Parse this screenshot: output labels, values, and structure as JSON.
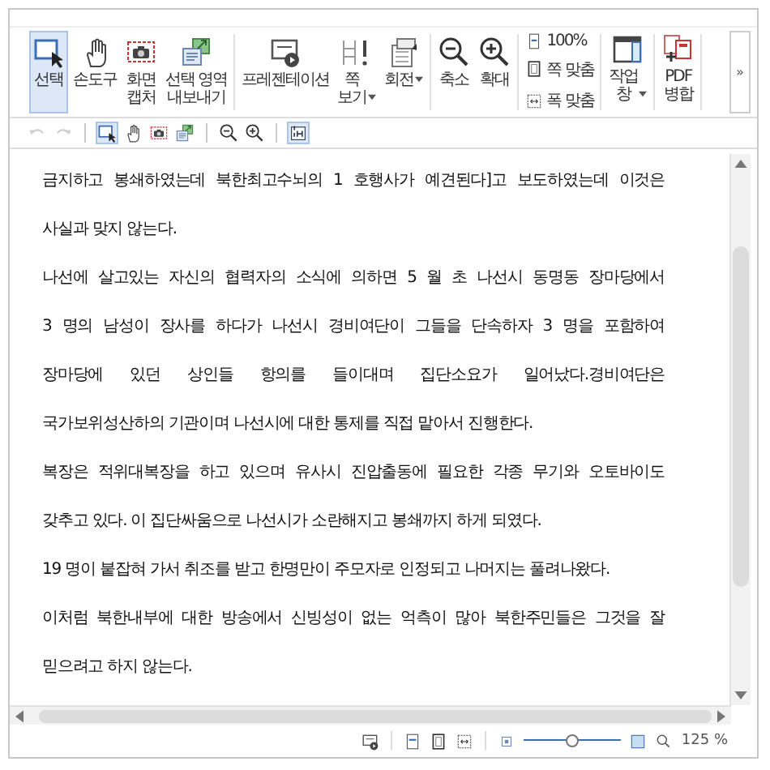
{
  "ribbon": {
    "groups": [
      {
        "buttons": [
          {
            "kind": "select",
            "label": "선택",
            "selected": true
          },
          {
            "kind": "hand",
            "label": "손도구",
            "selected": false
          },
          {
            "kind": "capture",
            "label": "화면\n캡처",
            "selected": false
          },
          {
            "kind": "export",
            "label": "선택 영역\n내보내기",
            "selected": false
          }
        ]
      },
      {
        "buttons": [
          {
            "kind": "present",
            "label": "프레젠테이션",
            "selected": false
          },
          {
            "kind": "pageview",
            "label": "쪽\n보기",
            "selected": false,
            "dropdown": true
          },
          {
            "kind": "rotate",
            "label": "회전",
            "selected": false,
            "dropdown": true
          }
        ]
      },
      {
        "buttons": [
          {
            "kind": "zoomout",
            "label": "축소",
            "selected": false
          },
          {
            "kind": "zoomin",
            "label": "확대",
            "selected": false
          }
        ]
      }
    ],
    "zoom_options": [
      {
        "kind": "actual",
        "label": "100%"
      },
      {
        "kind": "fitpage",
        "label": "쪽 맞춤"
      },
      {
        "kind": "fitwidth",
        "label": "폭 맞춤"
      }
    ],
    "end_buttons": [
      {
        "kind": "pane",
        "label": "작업\n창",
        "dropdown": true
      },
      {
        "kind": "pdfmerge",
        "label": "PDF\n병합",
        "dropdown": false
      }
    ],
    "more": "»"
  },
  "quick_toolbar": [
    {
      "kind": "undo",
      "selected": false,
      "disabled": true
    },
    {
      "kind": "redo",
      "selected": false,
      "disabled": true
    },
    {
      "kind": "select",
      "selected": true,
      "disabled": false
    },
    {
      "kind": "hand",
      "selected": false,
      "disabled": false
    },
    {
      "kind": "capture",
      "selected": false,
      "disabled": false
    },
    {
      "kind": "export",
      "selected": false,
      "disabled": false
    },
    {
      "kind": "zoomout",
      "selected": false,
      "disabled": false
    },
    {
      "kind": "zoomin",
      "selected": false,
      "disabled": false
    },
    {
      "kind": "fit",
      "selected": true,
      "disabled": false
    }
  ],
  "document": {
    "lines": [
      {
        "text": "금지하고 봉쇄하였는데 북한최고수뇌의 1 호행사가 예견된다]고 보도하였는데 이것은",
        "paragraph_end": false
      },
      {
        "text": "사실과 맞지 않는다.",
        "paragraph_end": true
      },
      {
        "text": "나선에 살고있는 자신의 협력자의 소식에 의하면 5 월 초 나선시 동명동 장마당에서",
        "paragraph_end": false
      },
      {
        "text": "3 명의 남성이 장사를 하다가 나선시 경비여단이 그들을 단속하자 3 명을 포함하여",
        "paragraph_end": false
      },
      {
        "text": "장마당에 있던 상인들 항의를 들이대며 집단소요가 일어났다.경비여단은",
        "paragraph_end": false
      },
      {
        "text": "국가보위성산하의 기관이며 나선시에 대한 통제를 직접 맡아서 진행한다.",
        "paragraph_end": true
      },
      {
        "text": "복장은 적위대복장을 하고 있으며 유사시 진압출동에 필요한 각종 무기와 오토바이도",
        "paragraph_end": false
      },
      {
        "text": "갖추고 있다. 이 집단싸움으로 나선시가 소란해지고 봉쇄까지 하게 되였다.",
        "paragraph_end": true
      },
      {
        "text": "19 명이 붙잡혀 가서 취조를 받고 한명만이 주모자로 인정되고 나머지는 풀려나왔다.",
        "paragraph_end": true
      },
      {
        "text": "이처럼 북한내부에 대한 방송에서 신빙성이 없는 억측이 많아 북한주민들은 그것을 잘",
        "paragraph_end": false
      },
      {
        "text": "믿으려고 하지 않는다.",
        "paragraph_end": true
      }
    ]
  },
  "status_bar": {
    "zoom_slider": {
      "level": 0.5
    },
    "zoom": "125 %"
  }
}
